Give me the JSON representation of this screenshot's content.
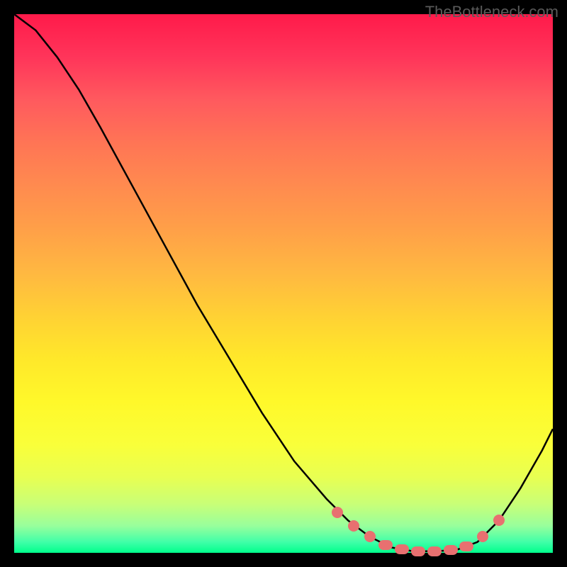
{
  "attribution": "TheBottleneck.com",
  "chart_data": {
    "type": "line",
    "title": "",
    "xlabel": "",
    "ylabel": "",
    "xlim": [
      0,
      100
    ],
    "ylim": [
      0,
      100
    ],
    "curve_xy": [
      [
        0,
        100
      ],
      [
        4,
        97
      ],
      [
        8,
        92
      ],
      [
        12,
        86
      ],
      [
        16,
        79
      ],
      [
        22,
        68
      ],
      [
        28,
        57
      ],
      [
        34,
        46
      ],
      [
        40,
        36
      ],
      [
        46,
        26
      ],
      [
        52,
        17
      ],
      [
        58,
        10
      ],
      [
        62,
        6
      ],
      [
        66,
        3
      ],
      [
        70,
        1
      ],
      [
        74,
        0.3
      ],
      [
        78,
        0.3
      ],
      [
        82,
        0.5
      ],
      [
        86,
        2
      ],
      [
        90,
        6
      ],
      [
        94,
        12
      ],
      [
        98,
        19
      ],
      [
        100,
        23
      ]
    ],
    "highlight_markers_x": [
      60,
      63,
      66,
      69,
      72,
      75,
      78,
      81,
      84,
      87,
      90
    ],
    "highlight_markers_y": [
      7.5,
      5,
      3,
      1.5,
      0.7,
      0.3,
      0.3,
      0.5,
      1.2,
      3,
      6
    ],
    "gradient_description": "vertical heat gradient red(top) to green(bottom)"
  }
}
